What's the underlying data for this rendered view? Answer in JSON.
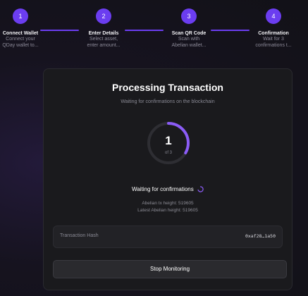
{
  "stepper": {
    "steps": [
      {
        "number": "1",
        "title": "Connect Wallet",
        "line1": "Connect your",
        "line2": "QDay wallet to..."
      },
      {
        "number": "2",
        "title": "Enter Details",
        "line1": "Select asset,",
        "line2": "enter amount..."
      },
      {
        "number": "3",
        "title": "Scan QR Code",
        "line1": "Scan with",
        "line2": "Abelian wallet..."
      },
      {
        "number": "4",
        "title": "Confirmation",
        "line1": "Wait for 3",
        "line2": "confirmations t..."
      }
    ]
  },
  "card": {
    "title": "Processing Transaction",
    "subtitle": "Waiting for confirmations on the blockchain",
    "progress": {
      "current": "1",
      "of_label": "of 3",
      "fraction": 0.333
    },
    "waiting_text": "Waiting for confirmations",
    "tx_height": "Abelian tx height: 519605",
    "latest_height": "Latest Abelian height: 519605",
    "hash": {
      "label": "Transaction Hash",
      "value": "0xaf28…1a50"
    },
    "stop_button": "Stop Monitoring"
  },
  "colors": {
    "accent": "#6b3df0",
    "ring_progress": "#8b5cf6",
    "ring_track": "#2e2e33"
  },
  "icons": {
    "spinner": "spinner-icon"
  }
}
